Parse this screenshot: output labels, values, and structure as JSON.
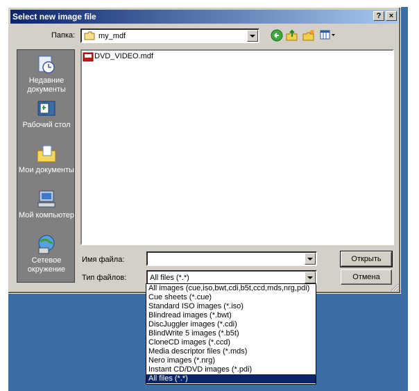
{
  "dialog": {
    "title": "Select new image file",
    "help_btn": "?",
    "close_btn": "×"
  },
  "lookin": {
    "label": "Папка:",
    "value": "my_mdf"
  },
  "places": [
    {
      "label": "Недавние документы",
      "icon": "recent-documents-icon"
    },
    {
      "label": "Рабочий стол",
      "icon": "desktop-icon"
    },
    {
      "label": "Мои документы",
      "icon": "my-documents-icon"
    },
    {
      "label": "Мой компьютер",
      "icon": "my-computer-icon"
    },
    {
      "label": "Сетевое окружение",
      "icon": "network-icon"
    }
  ],
  "files": [
    {
      "name": "DVD_VIDEO.mdf",
      "icon": "mdf-file-icon"
    }
  ],
  "filename": {
    "label": "Имя файла:",
    "value": ""
  },
  "filetype": {
    "label": "Тип файлов:",
    "value": "All files (*.*)"
  },
  "buttons": {
    "open": "Открыть",
    "cancel": "Отмена"
  },
  "filetype_options": [
    "All images (cue,iso,bwt,cdi,b5t,ccd,mds,nrg,pdi)",
    "Cue sheets (*.cue)",
    "Standard ISO images (*.iso)",
    "Blindread images (*.bwt)",
    "DiscJuggler images (*.cdi)",
    "BlindWrite 5 images (*.b5t)",
    "CloneCD images (*.ccd)",
    "Media descriptor files (*.mds)",
    "Nero images (*.nrg)",
    "Instant CD/DVD images (*.pdi)",
    "All files (*.*)"
  ],
  "selected_option_index": 10,
  "colors": {
    "title_start": "#0a246a",
    "title_end": "#a6caf0",
    "desktop": "#3a6ea5",
    "face": "#d4d0c8",
    "selection": "#0a246a"
  }
}
